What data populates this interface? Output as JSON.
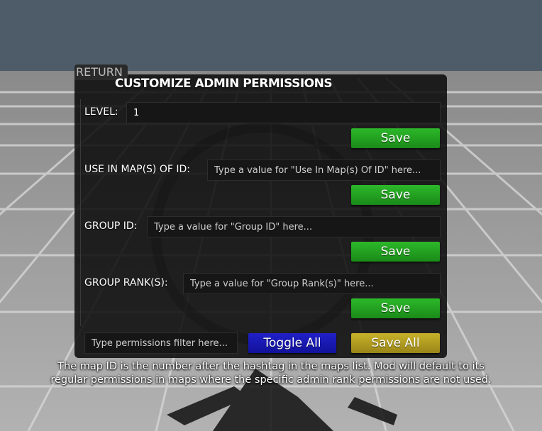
{
  "header": {
    "return_label": "RETURN",
    "title": "CUSTOMIZE ADMIN PERMISSIONS"
  },
  "fields": [
    {
      "label": "LEVEL:",
      "value": "1",
      "placeholder": "",
      "save_label": "Save"
    },
    {
      "label": "USE IN MAP(S) OF ID:",
      "value": "",
      "placeholder": "Type a value for \"Use In Map(s) Of ID\" here...",
      "save_label": "Save"
    },
    {
      "label": "GROUP ID:",
      "value": "",
      "placeholder": "Type a value for \"Group ID\" here...",
      "save_label": "Save"
    },
    {
      "label": "GROUP RANK(S):",
      "value": "",
      "placeholder": "Type a value for \"Group Rank(s)\" here...",
      "save_label": "Save"
    }
  ],
  "footer": {
    "filter_placeholder": "Type permissions filter here...",
    "toggle_all_label": "Toggle All",
    "save_all_label": "Save All"
  },
  "note": {
    "line1": "The map ID is the number after the hashtag in the maps list. Mod will default to its",
    "line2": "regular permissions in maps where the specific admin rank permissions are not used."
  },
  "colors": {
    "save_green": "#23a521",
    "toggle_blue": "#1818b4",
    "save_all_gold": "#b49e20",
    "panel_bg": "#0c0c0c"
  },
  "icons": [
    "emblem-logo"
  ]
}
